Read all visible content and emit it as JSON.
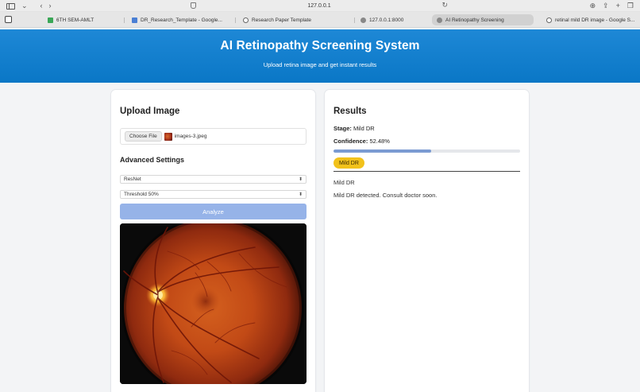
{
  "browser": {
    "url": "127.0.0.1",
    "tabs": [
      {
        "label": "6TH SEM-AMLT",
        "favicon": "green"
      },
      {
        "label": "DR_Research_Template - Google...",
        "favicon": "blue"
      },
      {
        "label": "Research Paper Template",
        "favicon": "circle"
      },
      {
        "label": "127.0.0.1:8000",
        "favicon": "gray"
      },
      {
        "label": "AI Retinopathy Screening",
        "favicon": "gray"
      },
      {
        "label": "retinal mild DR image - Google S...",
        "favicon": "circle"
      }
    ],
    "active_tab_index": 4
  },
  "header": {
    "title": "AI Retinopathy Screening System",
    "subtitle": "Upload retina image and get instant results",
    "color": "#0a7bc9"
  },
  "upload": {
    "heading": "Upload Image",
    "choose_label": "Choose File",
    "file_name": "images-3.jpeg",
    "advanced_heading": "Advanced Settings",
    "model_value": "ResNet",
    "threshold_value": "Threshold 50%",
    "analyze_label": "Analyze"
  },
  "results": {
    "heading": "Results",
    "stage_label": "Stage:",
    "stage_value": "Mild DR",
    "confidence_label": "Confidence:",
    "confidence_value": "52.48%",
    "confidence_fraction": 0.5248,
    "badge": "Mild DR",
    "badge_color": "#f2c21b",
    "line1": "Mild DR",
    "line2": "Mild DR detected. Consult doctor soon."
  }
}
